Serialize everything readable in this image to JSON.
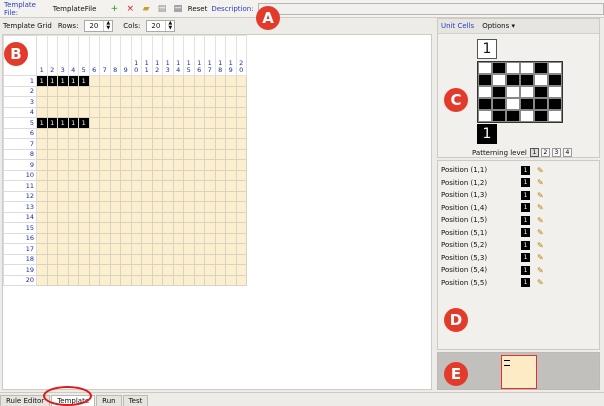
{
  "toolbar": {
    "template_file_label": "Template File:",
    "template_file_value": "TemplateFile",
    "reset_label": "Reset",
    "description_label": "Description:"
  },
  "gridbar": {
    "title": "Template Grid",
    "rows_label": "Rows:",
    "rows_value": "20",
    "cols_label": "Cols:",
    "cols_value": "20"
  },
  "grid": {
    "rows": 20,
    "cols": 20,
    "filled": [
      [
        1,
        1
      ],
      [
        1,
        2
      ],
      [
        1,
        3
      ],
      [
        1,
        4
      ],
      [
        1,
        5
      ],
      [
        5,
        1
      ],
      [
        5,
        2
      ],
      [
        5,
        3
      ],
      [
        5,
        4
      ],
      [
        5,
        5
      ]
    ],
    "cell_value": "1"
  },
  "unit_cells": {
    "tab_label": "Unit Cells",
    "options_label": "Options",
    "top_value": "1",
    "bottom_value": "1",
    "pattern": [
      [
        0,
        1,
        0,
        0,
        1,
        0
      ],
      [
        1,
        0,
        1,
        1,
        0,
        1
      ],
      [
        0,
        1,
        0,
        0,
        1,
        0
      ],
      [
        1,
        1,
        0,
        1,
        1,
        1
      ],
      [
        0,
        1,
        1,
        0,
        1,
        0
      ]
    ],
    "patterning_level_label": "Patterning level",
    "levels": [
      "1",
      "2",
      "3",
      "4"
    ],
    "selected_level": "1"
  },
  "positions": [
    {
      "label": "Position (1,1)",
      "value": "1"
    },
    {
      "label": "Position (1,2)",
      "value": "1"
    },
    {
      "label": "Position (1,3)",
      "value": "1"
    },
    {
      "label": "Position (1,4)",
      "value": "1"
    },
    {
      "label": "Position (1,5)",
      "value": "1"
    },
    {
      "label": "Position (5,1)",
      "value": "1"
    },
    {
      "label": "Position (5,2)",
      "value": "1"
    },
    {
      "label": "Position (5,3)",
      "value": "1"
    },
    {
      "label": "Position (5,4)",
      "value": "1"
    },
    {
      "label": "Position (5,5)",
      "value": "1"
    }
  ],
  "tabs": [
    {
      "label": "Rule Editor"
    },
    {
      "label": "Template"
    },
    {
      "label": "Run"
    },
    {
      "label": "Test"
    }
  ],
  "callouts": {
    "a": "A",
    "b": "B",
    "c": "C",
    "d": "D",
    "e": "E"
  },
  "colors": {
    "accent": "#2b3fbf",
    "grid_cell": "#fcefd0",
    "callout": "#e23b2b"
  }
}
